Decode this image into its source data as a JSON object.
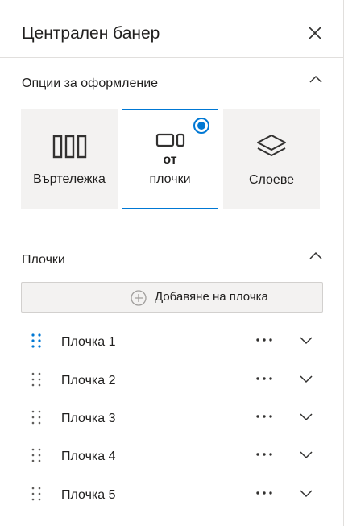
{
  "header": {
    "title": "Централен банер",
    "close_icon": "close-icon"
  },
  "layout_section": {
    "title": "Опции за оформление",
    "collapse_icon": "chevron-up-icon",
    "options": [
      {
        "label": "Въртележка",
        "icon": "carousel-icon",
        "selected": false
      },
      {
        "label_line1": "от",
        "label_line2": "плочки",
        "icon": "tiles-icon",
        "selected": true
      },
      {
        "label": "Слоеве",
        "icon": "layers-icon",
        "selected": false
      }
    ]
  },
  "tiles_section": {
    "title": "Плочки",
    "collapse_icon": "chevron-up-icon",
    "add_button_label": "Добавяне на плочка",
    "tiles": [
      {
        "label": "Плочка 1",
        "active": true
      },
      {
        "label": "Плочка 2",
        "active": false
      },
      {
        "label": "Плочка 3",
        "active": false
      },
      {
        "label": "Плочка 4",
        "active": false
      },
      {
        "label": "Плочка 5",
        "active": false
      }
    ]
  },
  "colors": {
    "accent": "#0078d4",
    "option_background": "#f3f2f1",
    "divider": "#e1dfdd"
  }
}
